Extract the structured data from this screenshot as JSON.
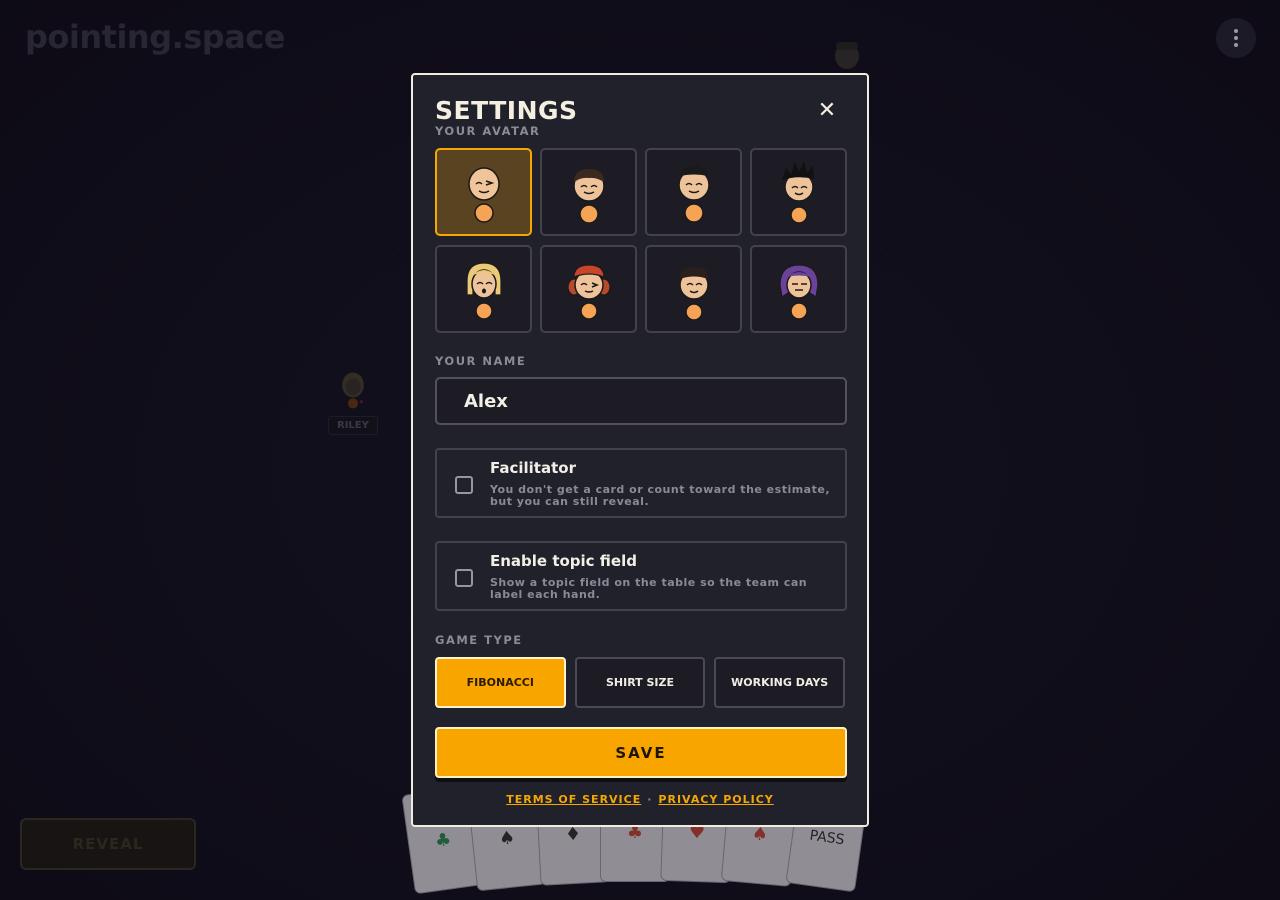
{
  "app": {
    "logo": "pointing.space",
    "players": [
      {
        "name": "RILEY"
      }
    ],
    "reveal_label": "REVEAL",
    "cards": [
      {
        "label": "♣",
        "color": "#2e8b57"
      },
      {
        "label": "♠",
        "color": "#333333"
      },
      {
        "label": "♦",
        "color": "#333333"
      },
      {
        "label": "♣",
        "color": "#c4473a"
      },
      {
        "label": "♥",
        "color": "#c4473a"
      },
      {
        "label": "♠",
        "color": "#c4473a"
      },
      {
        "label": "PASS",
        "color": "#333333"
      }
    ]
  },
  "modal": {
    "title": "SETTINGS",
    "close_icon": "close-icon",
    "avatar_label": "YOUR AVATAR",
    "avatars": [
      {
        "id": "bald-wink",
        "selected": true
      },
      {
        "id": "short-brown"
      },
      {
        "id": "curly-black"
      },
      {
        "id": "spiky-black"
      },
      {
        "id": "blonde-bob"
      },
      {
        "id": "red-hair-wink"
      },
      {
        "id": "short-dark"
      },
      {
        "id": "purple-hair"
      }
    ],
    "name_label": "YOUR NAME",
    "name_value": "Alex",
    "facilitator": {
      "title": "Facilitator",
      "desc": "You don't get a card or count toward the estimate, but you can still reveal.",
      "checked": false
    },
    "topic": {
      "title": "Enable topic field",
      "desc": "Show a topic field on the table so the team can label each hand.",
      "checked": false
    },
    "game_type_label": "GAME TYPE",
    "game_types": [
      "FIBONACCI",
      "SHIRT SIZE",
      "WORKING DAYS"
    ],
    "game_type_selected": "FIBONACCI",
    "save_label": "SAVE",
    "terms_label": "TERMS OF SERVICE",
    "separator": "·",
    "privacy_label": "PRIVACY POLICY"
  },
  "colors": {
    "accent": "#f9a500",
    "modal_bg": "#21212b",
    "page_bg": "#14121f"
  }
}
